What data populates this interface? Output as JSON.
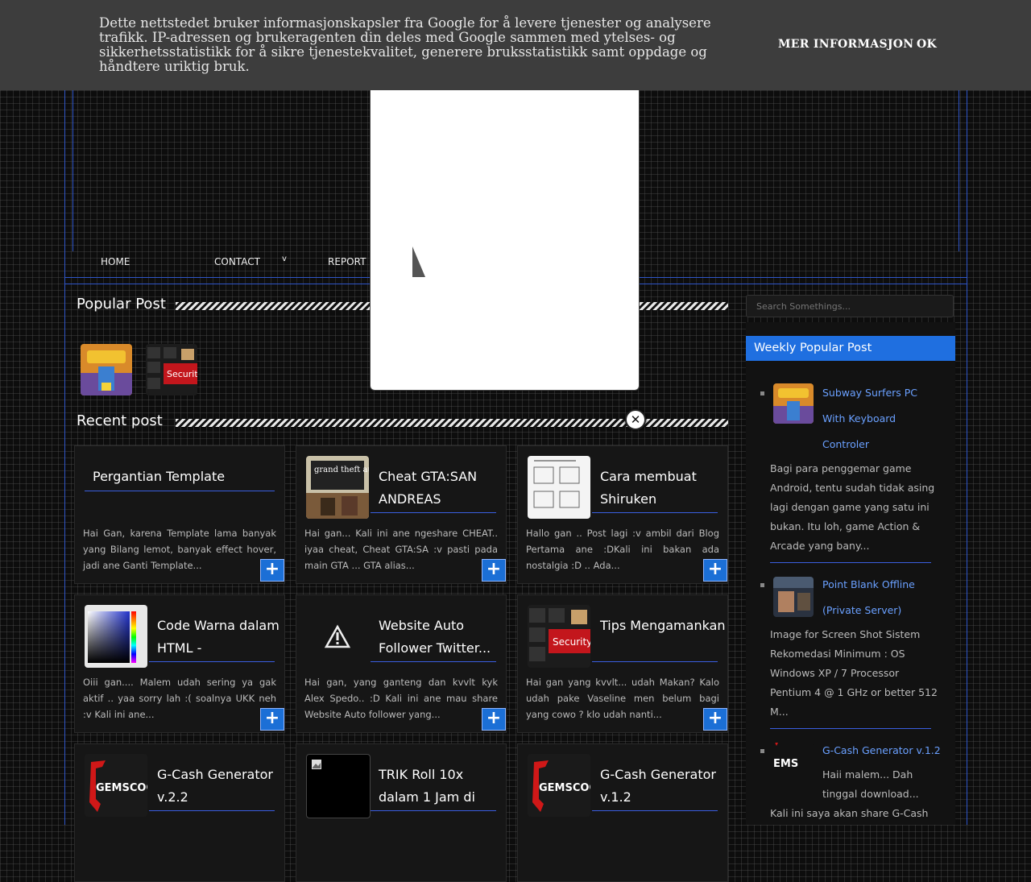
{
  "cookie": {
    "message": "Dette nettstedet bruker informasjonskapsler fra Google for å levere tjenester og analysere trafikk. IP-adressen og brukeragenten din deles med Google sammen med ytelses- og sikkerhetsstatistikk for å sikre tjenestekvalitet, generere bruksstatistikk samt oppdage og håndtere uriktig bruk.",
    "more_label": "MER INFORMASJON",
    "ok_label": "OK"
  },
  "nav": {
    "home": "HOME",
    "contact": "CONTACT",
    "contact_arrow": "v",
    "report": "REPORT"
  },
  "popular": {
    "title": "Popular Post"
  },
  "recent": {
    "title": "Recent post"
  },
  "popup": {
    "close": "✕"
  },
  "cards": [
    {
      "title": "Pergantian Template",
      "excerpt": "Hai Gan, karena Template lama banyak yang Bilang lemot, banyak effect hover, jadi ane Ganti Template..."
    },
    {
      "title": "Cheat GTA:SAN ANDREAS",
      "excerpt": "Hai gan... Kali ini ane ngeshare CHEAT.. iyaa cheat, Cheat GTA:SA :v pasti pada main GTA ... GTA alias..."
    },
    {
      "title": "Cara membuat Shiruken",
      "excerpt": "Hallo gan .. Post lagi :v ambil dari Blog Pertama ane :DKali ini bakan ada nostalgia :D .. Ada..."
    },
    {
      "title": "Code Warna dalam HTML -",
      "excerpt": "Oiii gan.... Malem udah sering ya gak aktif .. yaa sorry lah :( soalnya UKK neh :v Kali ini ane..."
    },
    {
      "title": "Website Auto Follower Twitter...",
      "excerpt": "Hai gan, yang ganteng dan kvvlt kyk Alex Spedo.. :D Kali ini ane mau share Website Auto follower yang..."
    },
    {
      "title": "Tips Mengamankan",
      "excerpt": "Hai gan yang kvvlt... udah Makan? Kalo udah pake Vaseline men belum bagi yang cowo ? klo udah nanti..."
    },
    {
      "title": "G-Cash Generator v.2.2",
      "excerpt": ""
    },
    {
      "title": "TRIK Roll 10x dalam 1 Jam di",
      "excerpt": ""
    },
    {
      "title": "G-Cash Generator v.1.2",
      "excerpt": ""
    }
  ],
  "plus": "+",
  "search": {
    "placeholder": "Search Somethings..."
  },
  "sidebar": {
    "title": "Weekly Popular Post",
    "items": [
      {
        "link1": "Subway Surfers PC",
        "link2": "With Keyboard",
        "link3": "Controler",
        "text": [
          "Bagi para penggemar game",
          "Android, tentu sudah tidak asing",
          "lagi dengan game yang satu ini",
          "bukan. Itu loh, game Action &",
          "Arcade yang bany..."
        ]
      },
      {
        "link1": "Point Blank Offline",
        "link2": "(Private Server)",
        "text": [
          "Image for Screen Shot     Sistem",
          "Rekomedasi Minimum : OS",
          "Windows XP / 7 Processor",
          "Pentium 4 @ 1 GHz or better 512",
          "M..."
        ]
      },
      {
        "link1": "G-Cash Generator v.1.2",
        "text_inline": [
          "Haii malem... Dah",
          "tinggal download..."
        ],
        "text": [
          "Kali ini saya akan share G-Cash"
        ]
      }
    ]
  },
  "thumb_text": {
    "gemscool": "GEMSCOOL",
    "security": "Security",
    "gta": "grand theft auto",
    "gems_side": "EMS"
  }
}
